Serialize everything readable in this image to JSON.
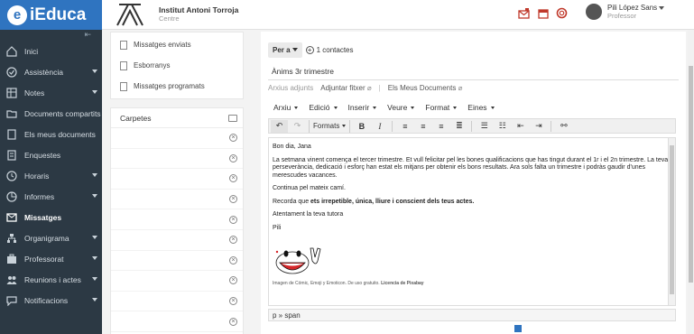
{
  "app": {
    "logo_text": "iEduca",
    "logo_mark": "e"
  },
  "header": {
    "school_name": "Institut Antoni Torroja",
    "school_role": "Centre",
    "user_name": "Pili López Sans",
    "user_role": "Professor"
  },
  "sidebar": {
    "items": [
      {
        "label": "Inici",
        "icon": "home-icon",
        "caret": false
      },
      {
        "label": "Assistència",
        "icon": "check-circle-icon",
        "caret": true
      },
      {
        "label": "Notes",
        "icon": "grid-icon",
        "caret": true
      },
      {
        "label": "Documents compartits",
        "icon": "folder-icon",
        "caret": false
      },
      {
        "label": "Els meus documents",
        "icon": "document-icon",
        "caret": false
      },
      {
        "label": "Enquestes",
        "icon": "survey-icon",
        "caret": false
      },
      {
        "label": "Horaris",
        "icon": "clock-icon",
        "caret": true
      },
      {
        "label": "Informes",
        "icon": "pie-chart-icon",
        "caret": true
      },
      {
        "label": "Missatges",
        "icon": "envelope-icon",
        "caret": false,
        "active": true
      },
      {
        "label": "Organigrama",
        "icon": "sitemap-icon",
        "caret": true
      },
      {
        "label": "Professorat",
        "icon": "briefcase-icon",
        "caret": true
      },
      {
        "label": "Reunions i actes",
        "icon": "users-icon",
        "caret": true
      },
      {
        "label": "Notificacions",
        "icon": "chat-icon",
        "caret": true
      }
    ]
  },
  "messages": {
    "links": [
      "Missatges enviats",
      "Esborranys",
      "Missatges programats"
    ],
    "folders_title": "Carpetes",
    "folder_count": 10
  },
  "compose": {
    "to_label": "Per a",
    "contacts": "1 contactes",
    "subject": "Ànims 3r trimestre",
    "attach_existing": "Arxius adjunts",
    "attach_file": "Adjuntar fitxer",
    "my_docs": "Els Meus Documents",
    "menu": [
      "Arxiu",
      "Edició",
      "Inserir",
      "Veure",
      "Format",
      "Eines"
    ],
    "formats_label": "Formats",
    "status_path": "p » span"
  },
  "body": {
    "greeting": "Bon dia, Jana",
    "para1": "La setmana vinent comença el tercer trimestre. Et vull felicitar pel les bones qualificacions que has tingut durant el  1r i el 2n trimestre. La teva perseverància, dedicació i esforç han estat els mitjans per obtenir els bons resultats. Ara sols falta un trimestre i podràs gaudir d'unes merescudes vacances.",
    "para2": "Continua pel mateix camí.",
    "para3_pre": "Recorda que ",
    "para3_bold": "ets irrepetible, única, lliure i conscient dels teus actes.",
    "closing": "Atentament la teva tutora",
    "signature": "Pili",
    "caption_pre": "Imagen de Cómic, Emoji y Emoticon. De uso gratuito. ",
    "caption_bold": "Licencia de Pixabay"
  }
}
